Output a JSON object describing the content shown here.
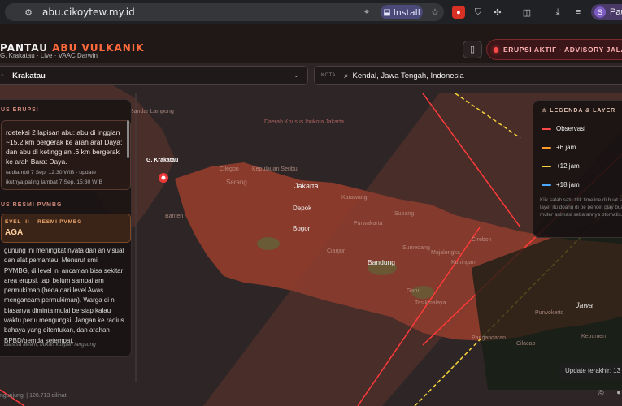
{
  "browser": {
    "url": "abu.cikoytew.my.id",
    "install_label": "Install",
    "profile_name": "Pau",
    "profile_initial": "S"
  },
  "header": {
    "title_prefix": "PANTAU",
    "title_accent": "ABU VULKANIK",
    "subtitle": "G. Krakatau · Live · VAAC Darwin",
    "status": "ERUPSI AKTIF · ADVISORY JALAN",
    "accent_color": "#ff6a3d"
  },
  "search": {
    "volcano_value": "Krakatau",
    "city_label": "KOTA",
    "city_value": "Kendal, Jawa Tengah, Indonesia"
  },
  "left_panel": {
    "status_heading": "US ERUPSI",
    "eruption_text": "rdeteksi 2 lapisan abu: abu di inggian ~15.2 km bergerak ke arah arat Daya; dan abu di ketinggian .6 km bergerak ke arah Barat Daya.",
    "meta_taken": "ta diambil 7 Sep, 12:30 WIB · update",
    "meta_next": "ikutnya paling lambat 7 Sep, 15:30 WIB",
    "pvmbg_heading": "US RESMI PVMBG",
    "level_sub": "EVEL III – RESMI PVMBG",
    "level_main": "AGA",
    "level_desc": "gunung ini meningkat nyata dari an visual dan alat pemantau. Menurut smi PVMBG, di level ini ancaman bisa sekitar area erupsi, tapi belum sampai am permukiman (beda dari level Awas mengancam permukiman). Warga di n biasanya diminta mulai bersiap kalau waktu perlu mengungsi. Jangan ke radius bahaya yang ditentukan, dan arahan BPBD/pemda setempat.",
    "note": "bahasa awam, bukan kutipan langsung"
  },
  "legend": {
    "heading": "LEGENDA & LAYER",
    "items": [
      {
        "label": "Observasi",
        "color": "#ff4a4a"
      },
      {
        "label": "+6 jam",
        "color": "#ff9a2a"
      },
      {
        "label": "+12 jam",
        "color": "#f5d23a"
      },
      {
        "label": "+18 jam",
        "color": "#4aa8ff"
      }
    ],
    "help": "Klik salah satu titik timeline di buat sorot layer itu doang di pe pencet play buat muter animasi sebarannya otomatis."
  },
  "map": {
    "volcano_label": "G. Krakatau",
    "jawa_label": "Jawa",
    "places": [
      "Bandar Lampung",
      "Daerah Khusus Ibukota Jakarta",
      "Cilegon",
      "Serang",
      "Jakarta",
      "Karawang",
      "Depok",
      "Purwakarta",
      "Subang",
      "Bogor",
      "Cianjur",
      "Bandung",
      "Cirebon",
      "Sumedang",
      "Majalengka",
      "Kuningan",
      "Garut",
      "Tasikmalaya",
      "Banten",
      "Pangandaran",
      "Cilacap",
      "Purwokerto",
      "Kebumen",
      "Kepulauan Seribu"
    ]
  },
  "footer": {
    "update": "Update terakhir: 13",
    "visits": "ngunjungi | 128.713 dilihat"
  }
}
